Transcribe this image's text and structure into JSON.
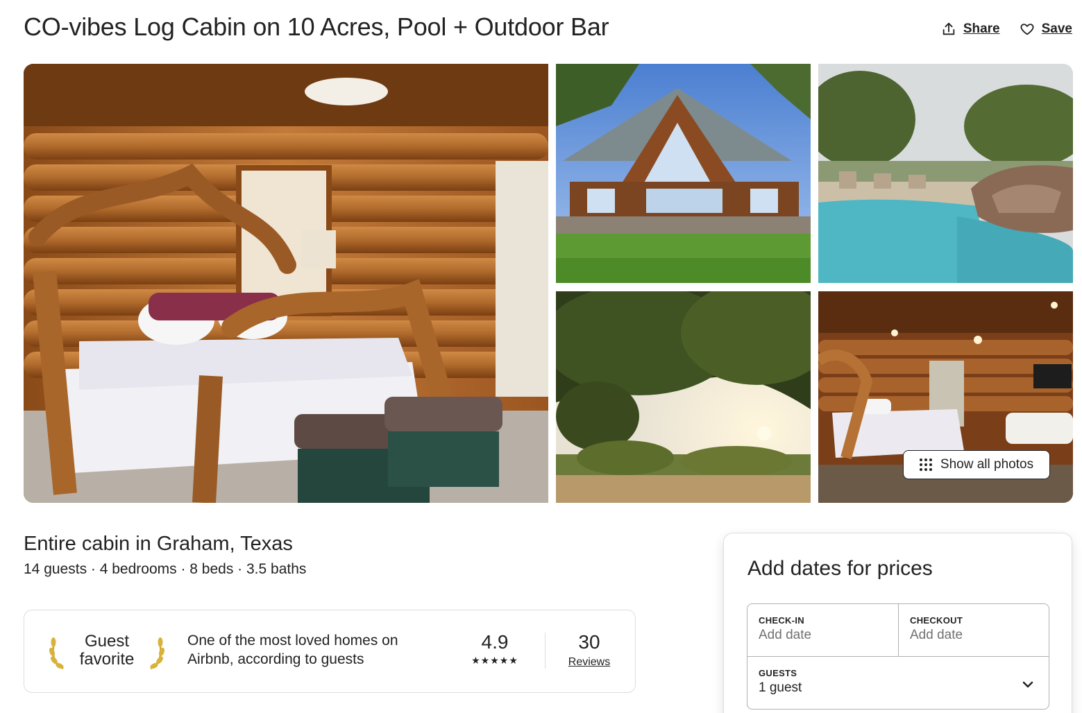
{
  "listing": {
    "title": "CO-vibes Log Cabin on 10 Acres, Pool + Outdoor Bar",
    "subtitle": "Entire cabin in Graham, Texas",
    "specs": "14 guests · 4 bedrooms · 8 beds · 3.5 baths"
  },
  "actions": {
    "share_label": "Share",
    "save_label": "Save",
    "share_icon": "share-icon",
    "save_icon": "heart-icon"
  },
  "gallery": {
    "show_all_label": "Show all photos",
    "photos": [
      "log cabin bedroom with rustic juniper bed",
      "log cabin exterior with A-frame windows",
      "pool with rock waterfall",
      "sunset view through oak trees",
      "bedroom with ceiling fan and sofa"
    ]
  },
  "guest_favorite": {
    "badge_line1": "Guest",
    "badge_line2": "favorite",
    "description": "One of the most loved homes on Airbnb, according to guests",
    "rating": "4.9",
    "stars": "★★★★★",
    "review_count": "30",
    "reviews_label": "Reviews"
  },
  "booking": {
    "title": "Add dates for prices",
    "checkin_label": "CHECK-IN",
    "checkin_value": "Add date",
    "checkout_label": "CHECKOUT",
    "checkout_value": "Add date",
    "guests_label": "GUESTS",
    "guests_value": "1 guest"
  },
  "colors": {
    "text": "#222222",
    "muted": "#717171",
    "border": "#dddddd"
  }
}
